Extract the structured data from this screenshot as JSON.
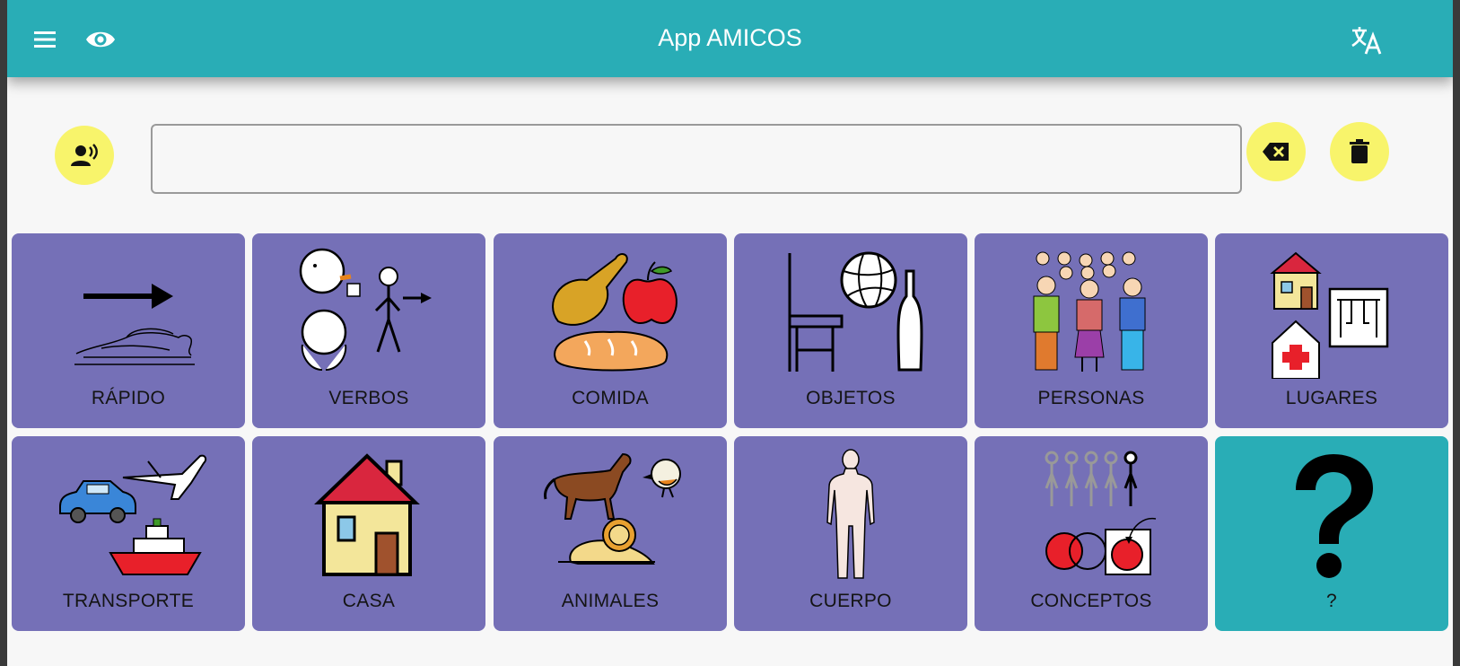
{
  "app_bar": {
    "title": "App AMICOS",
    "menu_icon": "menu-icon",
    "visibility_icon": "eye-icon",
    "language_icon": "translate-icon"
  },
  "sentence_bar": {
    "value": "",
    "speak_icon": "speak-icon",
    "backspace_icon": "backspace-icon",
    "clear_icon": "trash-icon"
  },
  "categories": [
    {
      "label": "RÁPIDO",
      "icon": "fast-running-rabbit-icon",
      "color": "#7570b7"
    },
    {
      "label": "VERBOS",
      "icon": "verbs-actions-icon",
      "color": "#7570b7"
    },
    {
      "label": "COMIDA",
      "icon": "food-icon",
      "color": "#7570b7"
    },
    {
      "label": "OBJETOS",
      "icon": "objects-icon",
      "color": "#7570b7"
    },
    {
      "label": "PERSONAS",
      "icon": "people-group-icon",
      "color": "#7570b7"
    },
    {
      "label": "LUGARES",
      "icon": "places-icon",
      "color": "#7570b7"
    },
    {
      "label": "TRANSPORTE",
      "icon": "transport-icon",
      "color": "#7570b7"
    },
    {
      "label": "CASA",
      "icon": "house-icon",
      "color": "#7570b7"
    },
    {
      "label": "ANIMALES",
      "icon": "animals-icon",
      "color": "#7570b7"
    },
    {
      "label": "CUERPO",
      "icon": "human-body-icon",
      "color": "#7570b7"
    },
    {
      "label": "CONCEPTOS",
      "icon": "concepts-icon",
      "color": "#7570b7"
    },
    {
      "label": "?",
      "icon": "question-mark-icon",
      "color": "#29adb6"
    }
  ],
  "colors": {
    "app_bar": "#29adb6",
    "tile": "#7570b7",
    "tile_special": "#29adb6",
    "action_button": "#f8f46b"
  }
}
